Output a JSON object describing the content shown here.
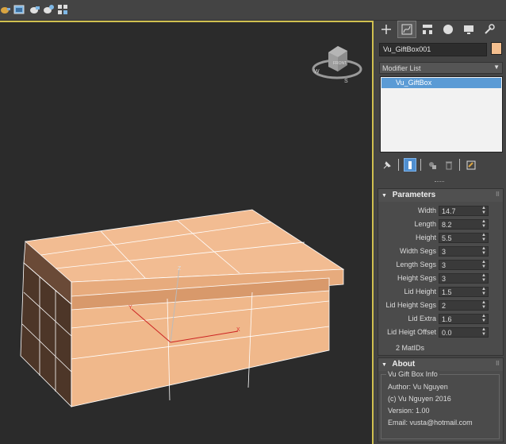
{
  "toolbar": {
    "icons": [
      "teapot-render-icon",
      "render-frame-window-icon",
      "render-production-icon",
      "render-iterative-icon",
      "render-online-icon"
    ]
  },
  "viewport": {
    "gizmo_labels": {
      "x": "X",
      "y": "Y",
      "z": "Z"
    },
    "viewcube_label": "FRONT",
    "box_color": "#f2bc92"
  },
  "command_panel": {
    "tabs": [
      "create-tab",
      "modify-tab",
      "hierarchy-tab",
      "motion-tab",
      "display-tab",
      "utilities-tab"
    ],
    "object_name": "Vu_GiftBox001",
    "object_color": "#f4bf8f",
    "modifier_list_label": "Modifier List",
    "stack_items": [
      "Vu_GiftBox"
    ]
  },
  "parameters": {
    "title": "Parameters",
    "rows": [
      {
        "label": "Width",
        "value": "14.7"
      },
      {
        "label": "Length",
        "value": "8.2"
      },
      {
        "label": "Height",
        "value": "5.5"
      },
      {
        "label": "Width Segs",
        "value": "3"
      },
      {
        "label": "Length Segs",
        "value": "3"
      },
      {
        "label": "Height Segs",
        "value": "3"
      },
      {
        "label": "Lid Height",
        "value": "1.5"
      },
      {
        "label": "Lid Height Segs",
        "value": "2"
      },
      {
        "label": "Lid Extra",
        "value": "1.6"
      },
      {
        "label": "Lid Heigt Offset",
        "value": "0.0"
      }
    ],
    "mat_ids": "2 MatIDs"
  },
  "about": {
    "title": "About",
    "group_title": "Vu Gift Box Info",
    "lines": [
      "Author: Vu Nguyen",
      "(c) Vu Nguyen 2016",
      "Version: 1.00",
      "Email: vusta@hotmail.com"
    ]
  }
}
